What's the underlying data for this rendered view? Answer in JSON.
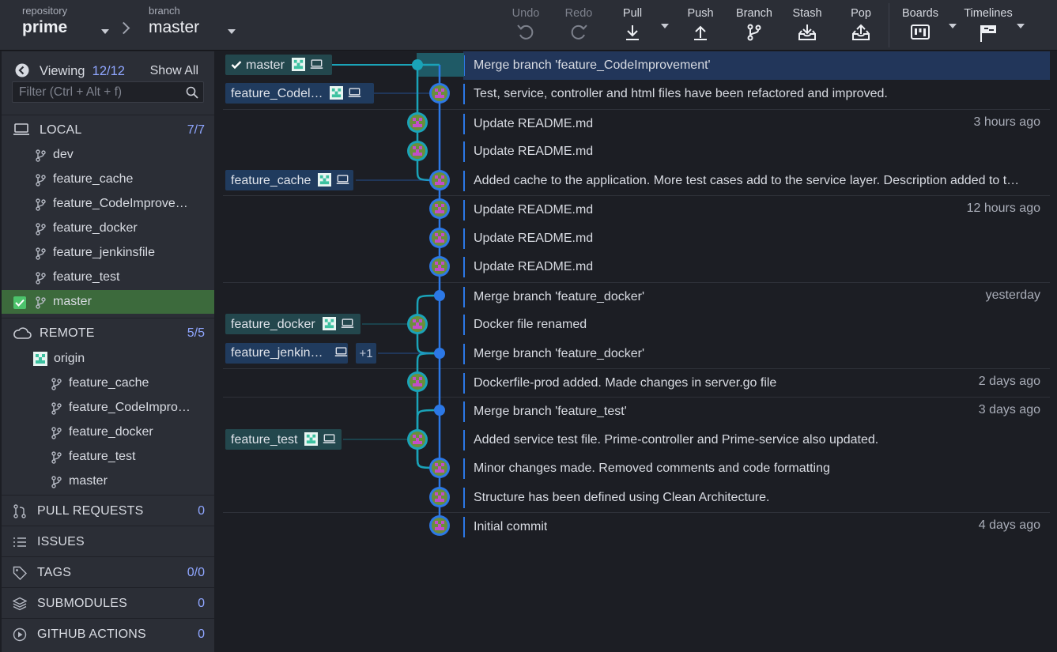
{
  "toolbar": {
    "repo_label": "repository",
    "repo_name": "prime",
    "branch_label": "branch",
    "branch_name": "master",
    "buttons": {
      "undo": "Undo",
      "redo": "Redo",
      "pull": "Pull",
      "push": "Push",
      "branch": "Branch",
      "stash": "Stash",
      "pop": "Pop",
      "boards": "Boards",
      "timelines": "Timelines"
    }
  },
  "sidebar": {
    "viewing_label": "Viewing",
    "viewing_count": "12/12",
    "show_all": "Show All",
    "filter_placeholder": "Filter (Ctrl + Alt + f)",
    "local": {
      "title": "LOCAL",
      "count": "7/7",
      "branches": [
        "dev",
        "feature_cache",
        "feature_CodeImprove…",
        "feature_docker",
        "feature_jenkinsfile",
        "feature_test",
        "master"
      ]
    },
    "remote": {
      "title": "REMOTE",
      "count": "5/5",
      "origin": "origin",
      "branches": [
        "feature_cache",
        "feature_CodeImpro…",
        "feature_docker",
        "feature_test",
        "master"
      ]
    },
    "sections": [
      {
        "title": "PULL REQUESTS",
        "count": "0",
        "icon": "pull-request-icon"
      },
      {
        "title": "ISSUES",
        "count": "",
        "icon": "list-icon"
      },
      {
        "title": "TAGS",
        "count": "0/0",
        "icon": "tag-icon"
      },
      {
        "title": "SUBMODULES",
        "count": "0",
        "icon": "layers-icon"
      },
      {
        "title": "GITHUB ACTIONS",
        "count": "0",
        "icon": "play-circle-icon"
      }
    ]
  },
  "graph": {
    "refs": {
      "master": "master",
      "feature_codeimprovement": "feature_Codel…",
      "feature_cache": "feature_cache",
      "feature_docker": "feature_docker",
      "feature_jenkins": "feature_jenkin…",
      "feature_jenkins_more": "+1",
      "feature_test": "feature_test"
    },
    "commits": [
      {
        "message": "Merge branch 'feature_CodeImprovement'",
        "time": ""
      },
      {
        "message": "Test, service, controller and html files have been refactored and improved.",
        "time": ""
      },
      {
        "message": "Update README.md",
        "time": "3 hours ago"
      },
      {
        "message": "Update README.md",
        "time": ""
      },
      {
        "message": "Added cache to the application. More test cases add to the service layer. Description added to t…",
        "time": ""
      },
      {
        "message": "Update README.md",
        "time": "12 hours ago"
      },
      {
        "message": "Update README.md",
        "time": ""
      },
      {
        "message": "Update README.md",
        "time": ""
      },
      {
        "message": "Merge branch 'feature_docker'",
        "time": "yesterday"
      },
      {
        "message": "Docker file renamed",
        "time": ""
      },
      {
        "message": "Merge branch 'feature_docker'",
        "time": ""
      },
      {
        "message": "Dockerfile-prod added. Made changes in server.go file",
        "time": "2 days ago"
      },
      {
        "message": "Merge branch 'feature_test'",
        "time": "3 days ago"
      },
      {
        "message": "Added service test file. Prime-controller and Prime-service also updated.",
        "time": ""
      },
      {
        "message": "Minor changes made. Removed comments and code formatting",
        "time": ""
      },
      {
        "message": "Structure has been defined using Clean Architecture.",
        "time": ""
      },
      {
        "message": "Initial commit",
        "time": "4 days ago"
      }
    ]
  },
  "colors": {
    "lane_master": "#2c78e6",
    "lane_feature": "#1aa3b8",
    "accent": "#8fa6ff",
    "selected_row": "#22365a",
    "active_branch": "#3c6a3c"
  }
}
